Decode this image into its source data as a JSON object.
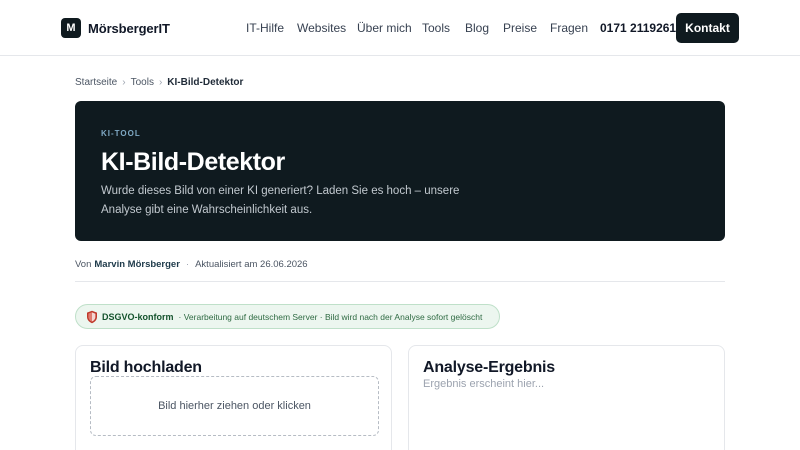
{
  "brand": {
    "logo_letter": "M",
    "name": "MörsbergerIT"
  },
  "nav": {
    "items": [
      "IT-Hilfe",
      "Websites",
      "Über mich",
      "Tools",
      "Blog",
      "Preise",
      "Fragen"
    ],
    "phone": "0171 2119261",
    "cta": "Kontakt"
  },
  "breadcrumb": {
    "home": "Startseite",
    "section": "Tools",
    "current": "KI-Bild-Detektor",
    "separator": "›"
  },
  "hero": {
    "kicker": "KI-TOOL",
    "title": "KI-Bild-Detektor",
    "description": "Wurde dieses Bild von einer KI generiert? Laden Sie es hoch – unsere Analyse gibt eine Wahrscheinlichkeit aus."
  },
  "meta": {
    "by_label": "Von",
    "author": "Marvin Mörsberger",
    "separator": "·",
    "updated": "Aktualisiert am 26.06.2026"
  },
  "gdpr": {
    "icon": "shield-icon",
    "label": "DSGVO-konform",
    "text": "· Verarbeitung auf deutschem Server · Bild wird nach der Analyse sofort gelöscht"
  },
  "upload": {
    "title": "Bild hochladen",
    "dropzone_text": "Bild hierher ziehen oder klicken"
  },
  "result": {
    "title": "Analyse-Ergebnis",
    "placeholder": "Ergebnis erscheint hier..."
  },
  "colors": {
    "primary_dark": "#0f1a1f",
    "kicker": "#7fa9c4",
    "badge_bg": "#ecf6ef",
    "badge_text": "#14532d"
  }
}
